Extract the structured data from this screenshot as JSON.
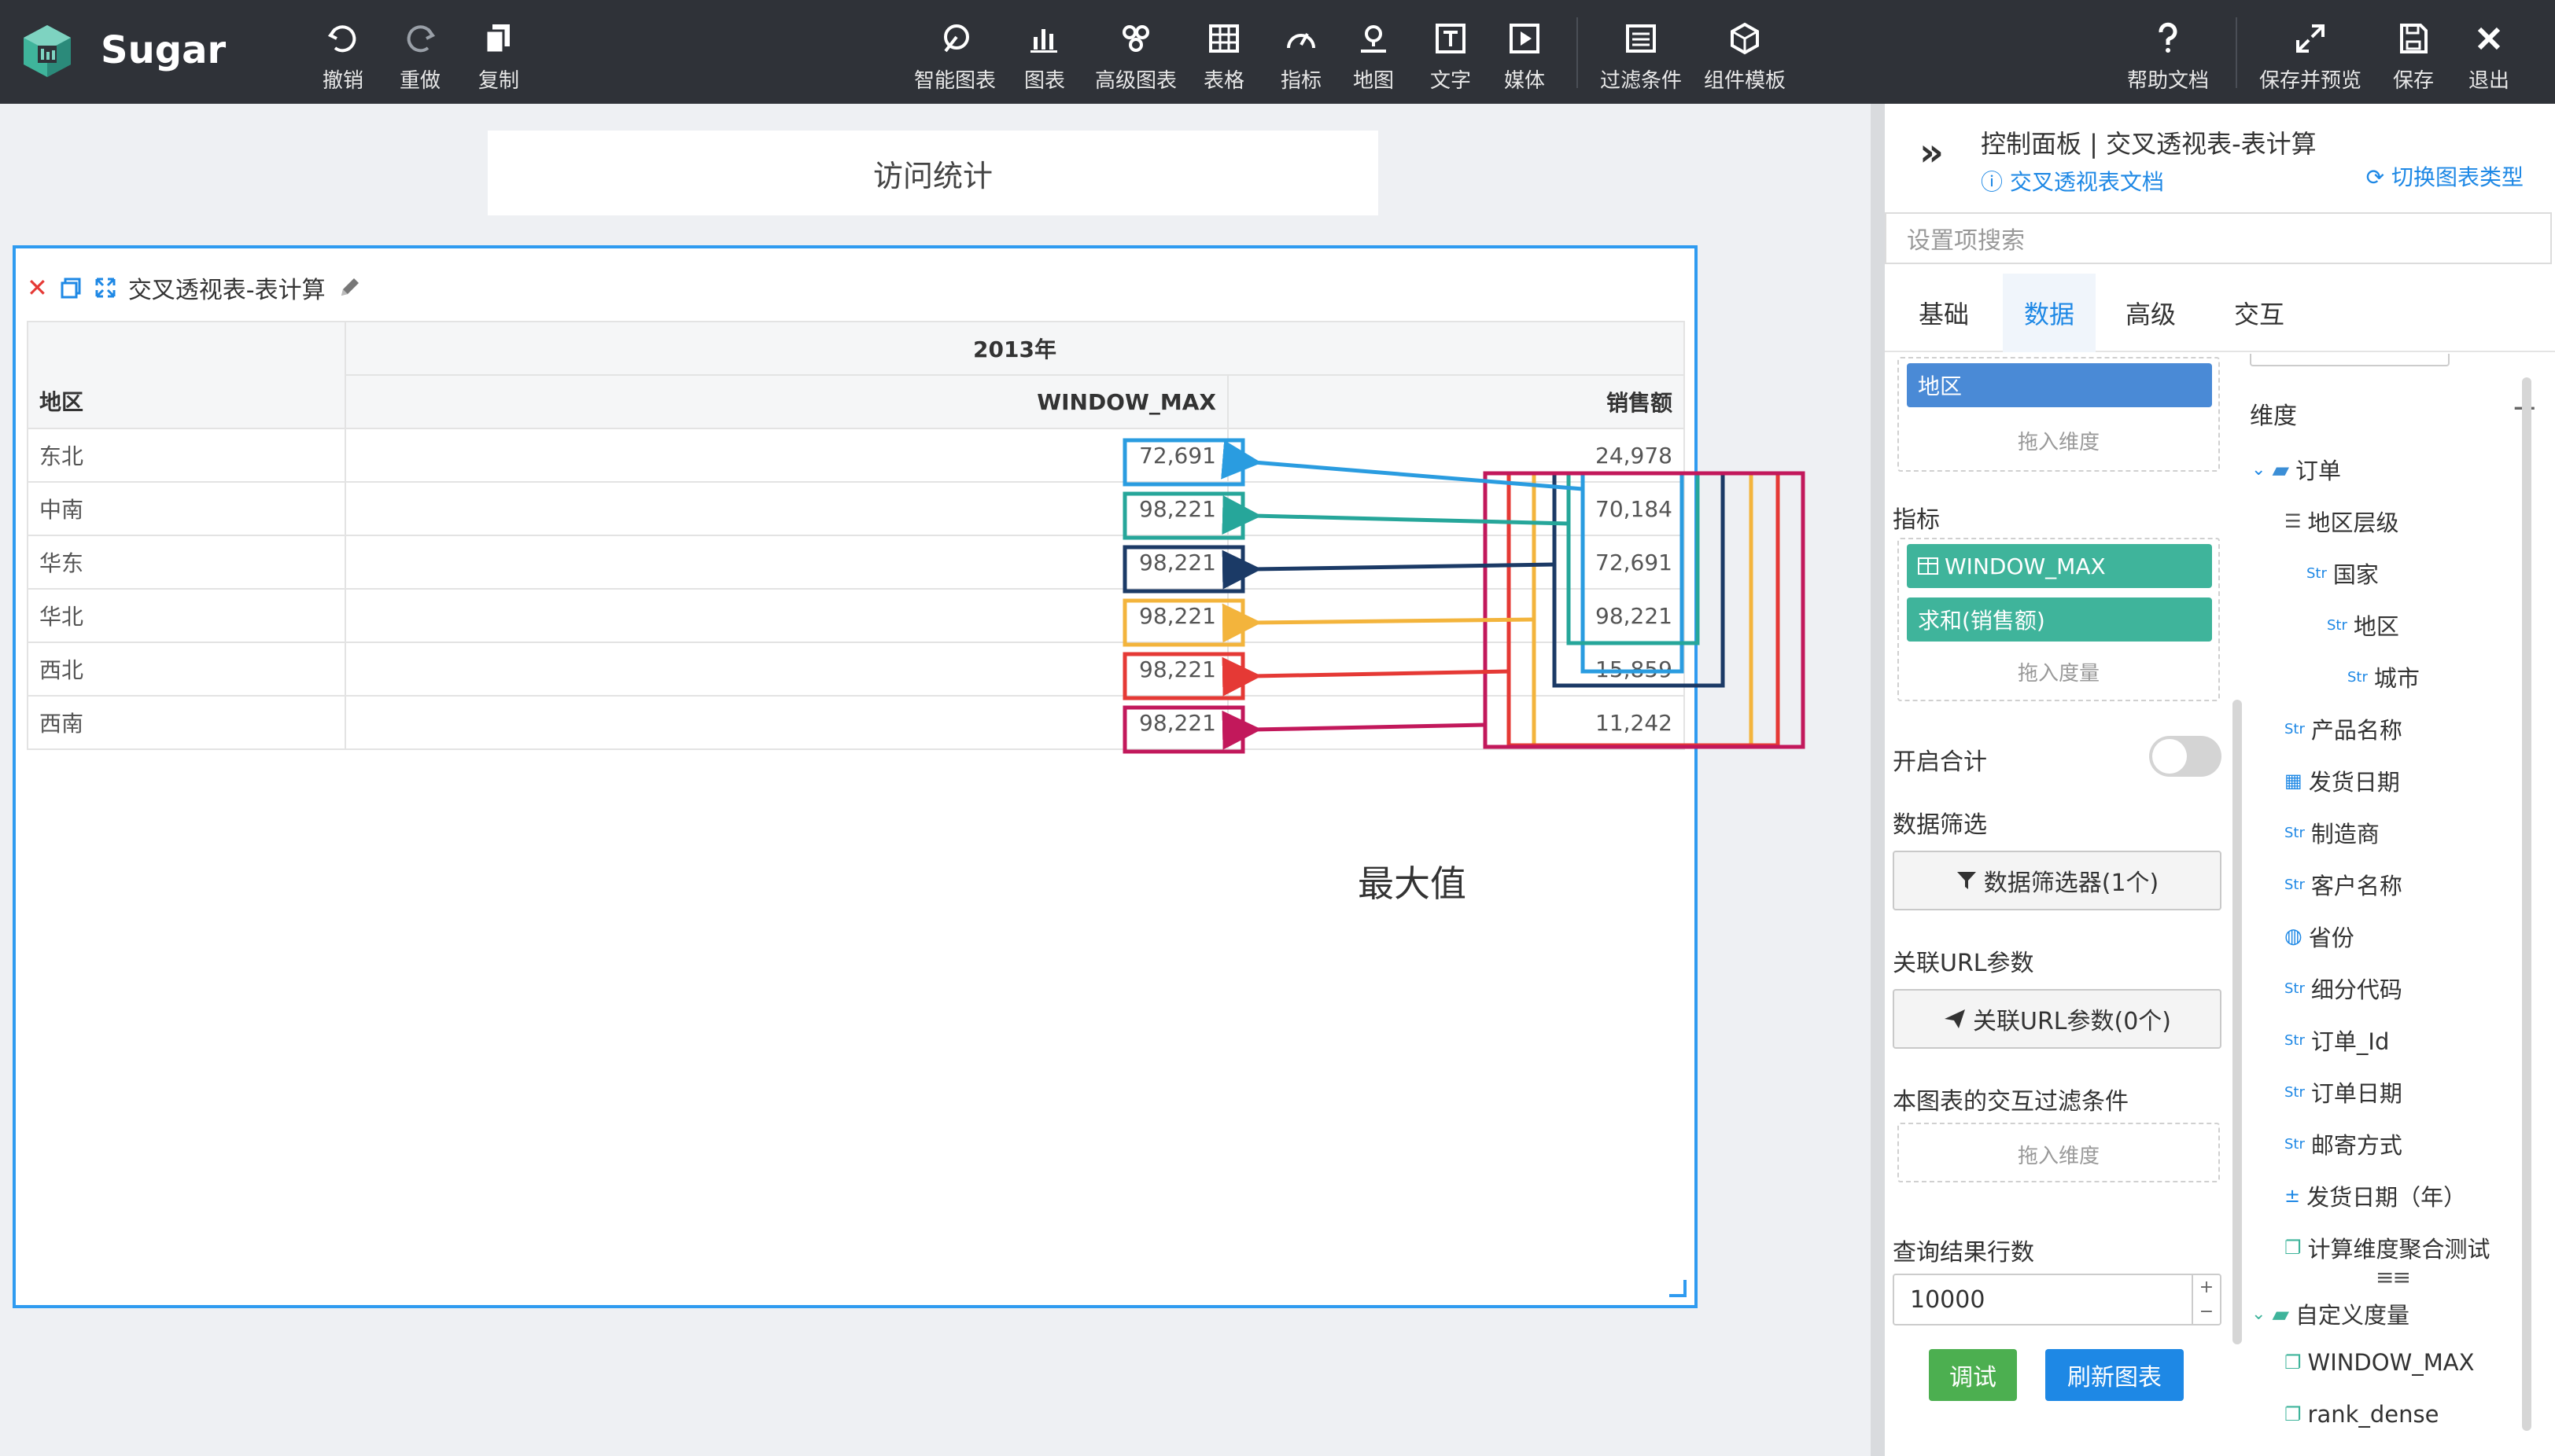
{
  "app": {
    "brand": "Sugar"
  },
  "toolbar": {
    "undo": "撤销",
    "redo": "重做",
    "copy": "复制",
    "smart_chart": "智能图表",
    "chart": "图表",
    "advanced_chart": "高级图表",
    "table": "表格",
    "indicator": "指标",
    "map": "地图",
    "text": "文字",
    "media": "媒体",
    "filter": "过滤条件",
    "component_template": "组件模板",
    "help_doc": "帮助文档",
    "save_preview": "保存并预览",
    "save": "保存",
    "exit": "退出"
  },
  "canvas": {
    "title": "访问统计",
    "widget_title": "交叉透视表-表计算",
    "annotation": "最大值",
    "table": {
      "year_header": "2013年",
      "row_header": "地区",
      "col_window_max": "WINDOW_MAX",
      "col_sales": "销售额",
      "rows": [
        {
          "region": "东北",
          "window_max": "72,691",
          "sales": "24,978"
        },
        {
          "region": "中南",
          "window_max": "98,221",
          "sales": "70,184"
        },
        {
          "region": "华东",
          "window_max": "98,221",
          "sales": "72,691"
        },
        {
          "region": "华北",
          "window_max": "98,221",
          "sales": "98,221"
        },
        {
          "region": "西北",
          "window_max": "98,221",
          "sales": "15,859"
        },
        {
          "region": "西南",
          "window_max": "98,221",
          "sales": "11,242"
        }
      ]
    },
    "annotation_colors": [
      "#2a9ce0",
      "#26a69a",
      "#1b3a66",
      "#f3b43c",
      "#e53935",
      "#c2185b"
    ]
  },
  "panel": {
    "title": "控制面板 | 交叉透视表-表计算",
    "doc_link": "交叉透视表文档",
    "switch_type": "切换图表类型",
    "search_placeholder": "设置项搜索",
    "tabs": [
      "基础",
      "数据",
      "高级",
      "交互"
    ],
    "active_tab": "数据",
    "dimension_pill": "地区",
    "drag_dimension": "拖入维度",
    "indicators_label": "指标",
    "indicator_pills": [
      "WINDOW_MAX",
      "求和(销售额)"
    ],
    "drag_measure": "拖入度量",
    "enable_total": "开启合计",
    "data_filter_label": "数据筛选",
    "data_filter_button": "数据筛选器(1个)",
    "url_param_label": "关联URL参数",
    "url_param_button": "关联URL参数(0个)",
    "interaction_filter_label": "本图表的交互过滤条件",
    "drag_dimension_2": "拖入维度",
    "query_rows_label": "查询结果行数",
    "query_rows_value": "10000",
    "debug_button": "调试",
    "refresh_button": "刷新图表",
    "dimension_header": "维度",
    "tree": {
      "order_folder": "订单",
      "region_level": "地区层级",
      "country": "国家",
      "region": "地区",
      "city": "城市",
      "product_name": "产品名称",
      "ship_date": "发货日期",
      "manufacturer": "制造商",
      "customer_name": "客户名称",
      "province": "省份",
      "segment_code": "细分代码",
      "order_id": "订单_Id",
      "order_date": "订单日期",
      "ship_mode": "邮寄方式",
      "ship_year": "发货日期（年）",
      "calc_dim_test": "计算维度聚合测试",
      "custom_measure_folder": "自定义度量",
      "window_max": "WINDOW_MAX",
      "rank_dense": "rank_dense"
    },
    "str_tag": "Str"
  }
}
